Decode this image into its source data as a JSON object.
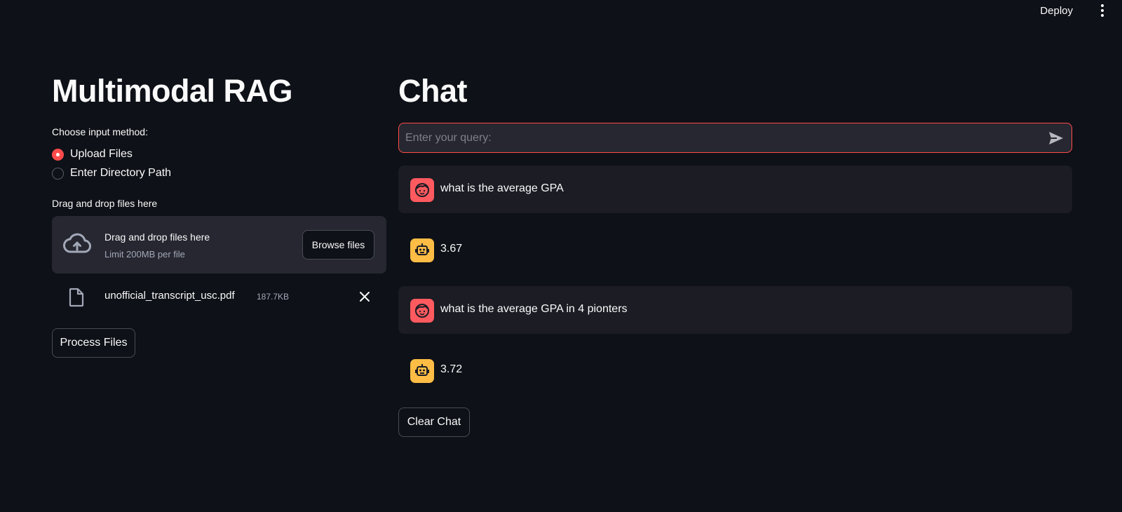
{
  "header": {
    "deploy_label": "Deploy",
    "menu_icon": "kebab-menu-icon"
  },
  "sidebar": {
    "title": "Multimodal RAG",
    "input_method_label": "Choose input method:",
    "radio_options": [
      {
        "label": "Upload Files",
        "checked": true
      },
      {
        "label": "Enter Directory Path",
        "checked": false
      }
    ],
    "uploader": {
      "label": "Drag and drop files here",
      "dropzone_title": "Drag and drop files here",
      "dropzone_limit": "Limit 200MB per file",
      "browse_label": "Browse files",
      "icon": "cloud-upload-icon"
    },
    "uploaded_file": {
      "name": "unofficial_transcript_usc.pdf",
      "size": "187.7KB",
      "icon": "file-icon"
    },
    "process_label": "Process Files"
  },
  "chat": {
    "title": "Chat",
    "query_placeholder": "Enter your query:",
    "query_value": "",
    "messages": [
      {
        "role": "user",
        "text": "what is the average GPA"
      },
      {
        "role": "assistant",
        "text": "3.67"
      },
      {
        "role": "user",
        "text": "what is the average GPA in 4 pionters"
      },
      {
        "role": "assistant",
        "text": "3.72"
      }
    ],
    "clear_label": "Clear Chat"
  },
  "colors": {
    "background": "#0e1117",
    "surface": "#262730",
    "accent": "#ff4b4b",
    "user_avatar": "#ff5a5f",
    "bot_avatar": "#ffbd45"
  }
}
